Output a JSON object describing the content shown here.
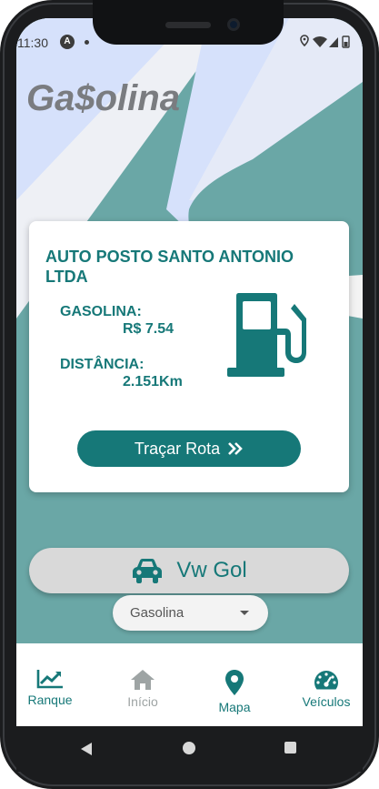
{
  "status_bar": {
    "time": "11:30",
    "app_badge": "A"
  },
  "app": {
    "logo_text": "Ga$olina"
  },
  "station": {
    "name": "AUTO POSTO SANTO ANTONIO LTDA",
    "fuel_label": "GASOLINA:",
    "price": "R$ 7.54",
    "distance_label": "DISTÂNCIA:",
    "distance": "2.151Km",
    "route_button": "Traçar Rota"
  },
  "vehicle": {
    "name": "Vw Gol"
  },
  "fuel_select": {
    "selected": "Gasolina"
  },
  "bottom_nav": {
    "items": [
      {
        "label": "Ranque",
        "icon": "chart-line-icon",
        "active": true
      },
      {
        "label": "Início",
        "icon": "home-icon",
        "active": false
      },
      {
        "label": "Mapa",
        "icon": "map-pin-icon",
        "active": true
      },
      {
        "label": "Veículos",
        "icon": "speedometer-icon",
        "active": true
      }
    ]
  },
  "colors": {
    "brand": "#167878",
    "background": "#6aa7a6",
    "inactive": "#9ea4a4",
    "logo": "#7a7c80"
  }
}
